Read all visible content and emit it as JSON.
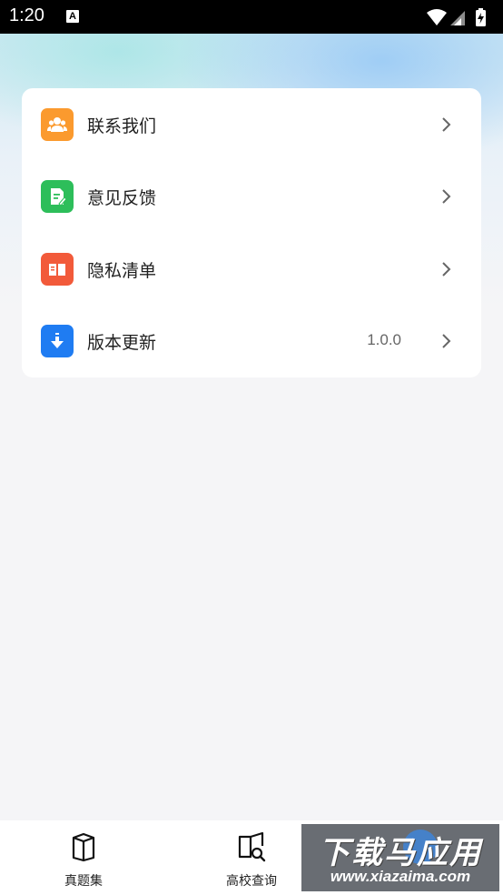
{
  "status_bar": {
    "time": "1:20",
    "notification_letter": "A",
    "icons": [
      "wifi-icon",
      "signal-icon",
      "battery-charging-icon"
    ]
  },
  "menu": {
    "items": [
      {
        "label": "联系我们",
        "value": "",
        "icon": "contact-people-icon",
        "color": "#FB9A2E"
      },
      {
        "label": "意见反馈",
        "value": "",
        "icon": "feedback-document-icon",
        "color": "#2DBE5A"
      },
      {
        "label": "隐私清单",
        "value": "",
        "icon": "privacy-book-icon",
        "color": "#F25A3A"
      },
      {
        "label": "版本更新",
        "value": "1.0.0",
        "icon": "download-arrow-icon",
        "color": "#1F7CF2"
      }
    ]
  },
  "bottom_nav": {
    "items": [
      {
        "label": "真题集",
        "icon": "book-box-icon"
      },
      {
        "label": "高校查询",
        "icon": "book-search-icon"
      }
    ]
  },
  "watermark": {
    "title": "下载马应用",
    "url": "www.xiazaima.com"
  }
}
